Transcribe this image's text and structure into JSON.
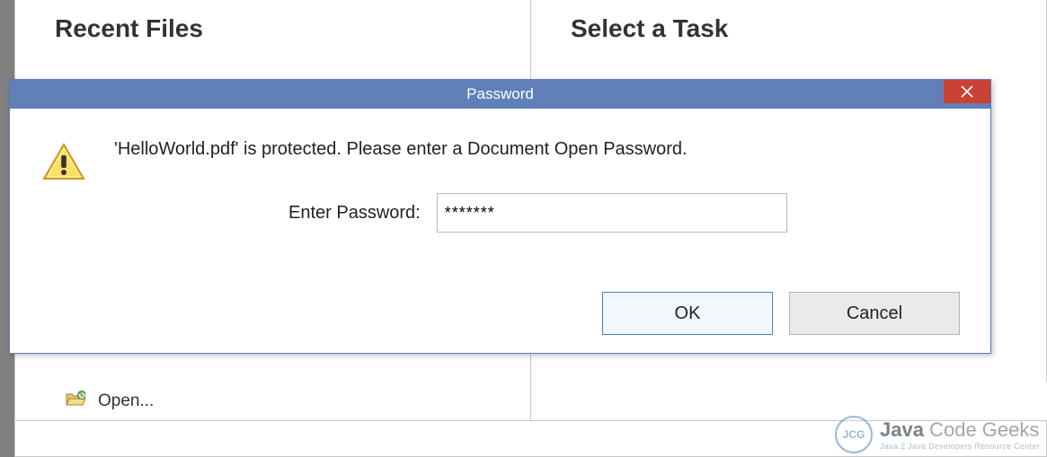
{
  "background": {
    "recent_heading": "Recent Files",
    "task_heading": "Select a Task",
    "open_label": "Open..."
  },
  "dialog": {
    "title": "Password",
    "message": "'HelloWorld.pdf' is protected. Please enter a Document Open Password.",
    "input_label": "Enter Password:",
    "input_value": "*******",
    "ok_label": "OK",
    "cancel_label": "Cancel"
  },
  "watermark": {
    "brand_main": "Java",
    "brand_rest": "Code Geeks",
    "sub": "Java 2 Java Developers Resource Center"
  }
}
